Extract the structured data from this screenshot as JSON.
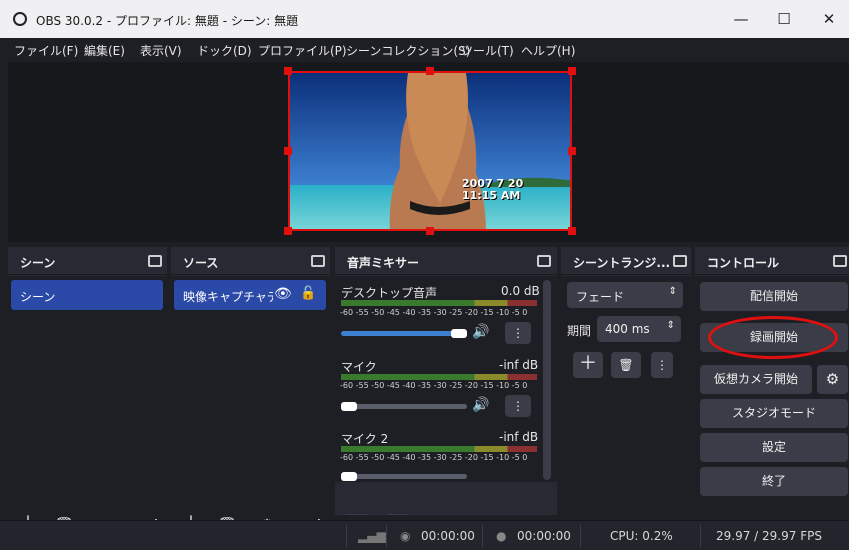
{
  "window": {
    "title": "OBS 30.0.2 - プロファイル: 無題 - シーン: 無題",
    "minimize": "—",
    "maximize": "☐",
    "close": "✕"
  },
  "menu": [
    "ファイル(F)",
    "編集(E)",
    "表示(V)",
    "ドック(D)",
    "プロファイル(P)",
    "シーンコレクション(S)",
    "ツール(T)",
    "ヘルプ(H)"
  ],
  "preview": {
    "timestamp_date": "2007  7 20",
    "timestamp_time": "11:15 AM"
  },
  "scenes": {
    "title": "シーン",
    "items": [
      "シーン"
    ]
  },
  "sources": {
    "title": "ソース",
    "items": [
      "映像キャプチャデ"
    ]
  },
  "mixer": {
    "title": "音声ミキサー",
    "ticks": "-60 -55 -50 -45 -40 -35 -30 -25 -20 -15 -10 -5 0",
    "channels": [
      {
        "name": "デスクトップ音声",
        "level": "0.0 dB",
        "volume": 1.0
      },
      {
        "name": "マイク",
        "level": "-inf dB",
        "volume": 0.0
      },
      {
        "name": "マイク 2",
        "level": "-inf dB",
        "volume": 0.0
      }
    ]
  },
  "transitions": {
    "title": "シーントランジ...",
    "type": "フェード",
    "duration_label": "期間",
    "duration": "400 ms"
  },
  "controls": {
    "title": "コントロール",
    "start_streaming": "配信開始",
    "start_recording": "録画開始",
    "start_virtual_cam": "仮想カメラ開始",
    "studio_mode": "スタジオモード",
    "settings": "設定",
    "exit": "終了"
  },
  "status": {
    "stream_time": "00:00:00",
    "rec_time": "00:00:00",
    "cpu": "CPU: 0.2%",
    "fps": "29.97 / 29.97 FPS"
  },
  "colors": {
    "accent": "#2b4aa8",
    "highlight": "#e01010"
  }
}
